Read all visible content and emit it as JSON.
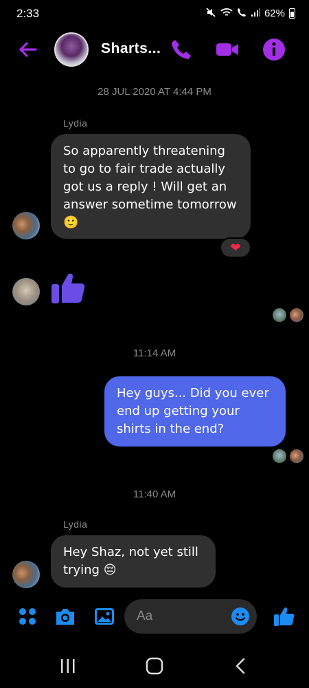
{
  "status_bar": {
    "time": "2:33",
    "battery": "62%"
  },
  "header": {
    "title": "Sharts..."
  },
  "messages": [
    {
      "type": "date",
      "text": "28 JUL 2020 AT 4:44 PM"
    },
    {
      "type": "sender",
      "text": "Lydia"
    },
    {
      "type": "incoming",
      "lines": [
        "So apparently threatening",
        "to go to fair trade actually",
        "got us a reply ! Will get an",
        "answer sometime tomorrow"
      ],
      "emoji": "🙂",
      "reaction": "❤"
    },
    {
      "type": "incoming_like"
    },
    {
      "type": "date",
      "text": "11:14 AM"
    },
    {
      "type": "outgoing",
      "lines": [
        "Hey guys... Did you ever",
        "end up getting your",
        "shirts in the end?"
      ]
    },
    {
      "type": "date",
      "text": "11:40 AM"
    },
    {
      "type": "sender",
      "text": "Lydia"
    },
    {
      "type": "incoming",
      "lines": [
        "Hey Shaz, not yet still",
        "trying"
      ],
      "emoji": "😔"
    }
  ],
  "composer": {
    "placeholder": "Aa"
  },
  "colors": {
    "accent": "#a22fe6",
    "outgoing_bubble": "#4f67e8",
    "incoming_bubble": "#303030",
    "messenger_blue": "#1d8cf2",
    "like_purple": "#6b4de6"
  }
}
